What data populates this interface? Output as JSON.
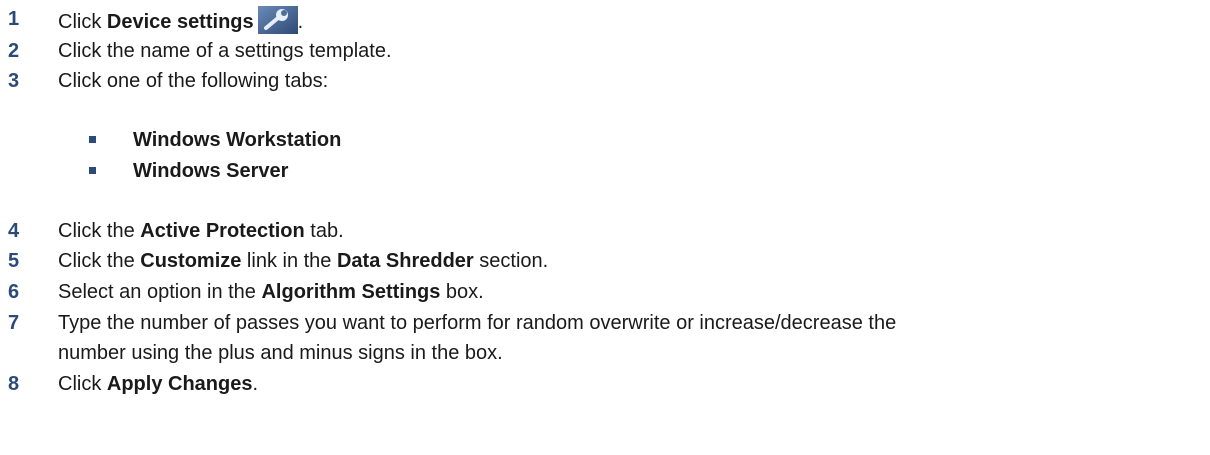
{
  "steps": [
    {
      "num": "1",
      "parts": [
        {
          "t": "Click "
        },
        {
          "b": "Device settings"
        },
        {
          "icon": "wrench-icon"
        },
        {
          "t": "."
        }
      ]
    },
    {
      "num": "2",
      "parts": [
        {
          "t": "Click the name of a settings template."
        }
      ]
    },
    {
      "num": "3",
      "parts": [
        {
          "t": "Click one of the following tabs:"
        }
      ]
    },
    {
      "num": "4",
      "parts": [
        {
          "t": "Click the "
        },
        {
          "b": "Active Protection"
        },
        {
          "t": " tab."
        }
      ]
    },
    {
      "num": "5",
      "parts": [
        {
          "t": "Click the "
        },
        {
          "b": "Customize"
        },
        {
          "t": " link in the "
        },
        {
          "b": "Data Shredder"
        },
        {
          "t": " section."
        }
      ]
    },
    {
      "num": "6",
      "parts": [
        {
          "t": "Select an option in the "
        },
        {
          "b": "Algorithm Settings"
        },
        {
          "t": " box."
        }
      ]
    },
    {
      "num": "7",
      "parts": [
        {
          "t": "Type the number of passes you want to perform for random overwrite or increase/decrease the"
        }
      ],
      "cont": "number using the plus and minus signs in the box."
    },
    {
      "num": "8",
      "parts": [
        {
          "t": "Click "
        },
        {
          "b": "Apply Changes"
        },
        {
          "t": "."
        }
      ]
    }
  ],
  "tabs": [
    "Windows Workstation",
    "Windows Server"
  ],
  "colors": {
    "number": "#2b4a7a",
    "text": "#1a1a1a",
    "icon_bg": "#4a6fa0"
  }
}
